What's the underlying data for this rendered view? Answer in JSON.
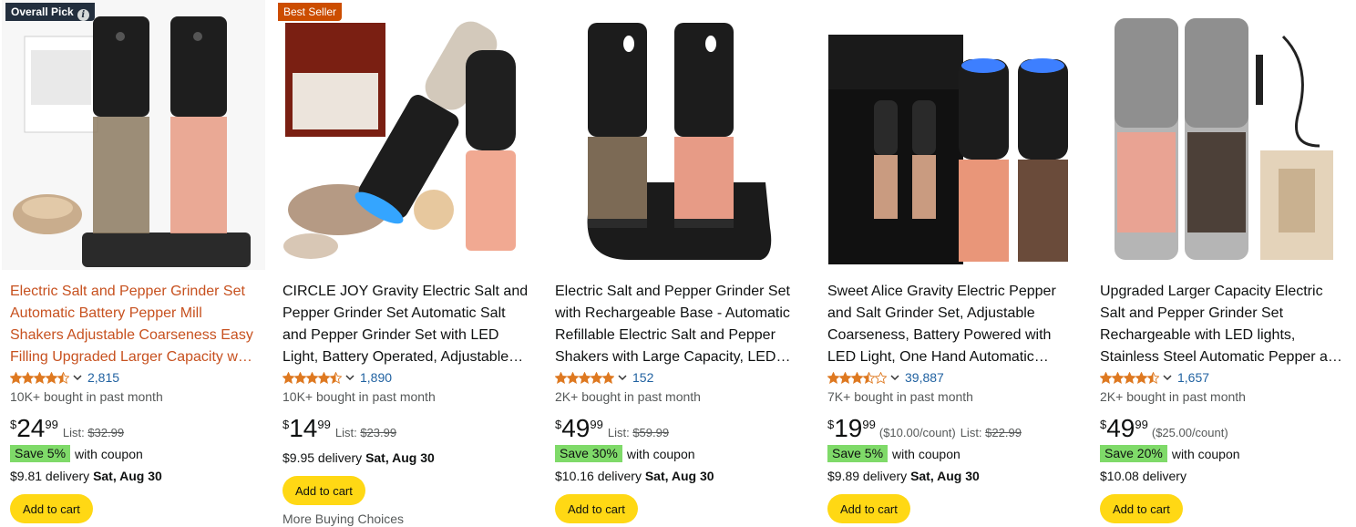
{
  "products": [
    {
      "badge": "Overall Pick",
      "badge_icon": "info-icon",
      "title": "Electric Salt and Pepper Grinder Set Automatic Battery Pepper Mill Shakers Adjustable Coarseness Easy Filling Upgraded Larger Capacity w…",
      "title_color": "#c7511f",
      "rating": 4.5,
      "rating_count": "2,815",
      "bought": "10K+ bought in past month",
      "price_symbol": "$",
      "price_whole": "24",
      "price_fraction": "99",
      "list_label": "List:",
      "list_price": "$32.99",
      "coupon_badge": "Save 5%",
      "coupon_text": "with coupon",
      "delivery_price": "$9.81 delivery",
      "delivery_date": "Sat, Aug 30",
      "cart_label": "Add to cart"
    },
    {
      "badge": "Best Seller",
      "title": "CIRCLE JOY Gravity Electric Salt and Pepper Grinder Set Automatic Salt and Pepper Grinder Set with LED Light, Battery Operated, Adjustable…",
      "rating": 4.5,
      "rating_count": "1,890",
      "bought": "10K+ bought in past month",
      "price_symbol": "$",
      "price_whole": "14",
      "price_fraction": "99",
      "list_label": "List:",
      "list_price": "$23.99",
      "delivery_price": "$9.95 delivery",
      "delivery_date": "Sat, Aug 30",
      "cart_label": "Add to cart",
      "more_choices": "More Buying Choices"
    },
    {
      "title": "Electric Salt and Pepper Grinder Set with Rechargeable Base - Automatic Refillable Electric Salt and Pepper Shakers with Large Capacity, LED…",
      "rating": 5,
      "rating_count": "152",
      "bought": "2K+ bought in past month",
      "price_symbol": "$",
      "price_whole": "49",
      "price_fraction": "99",
      "list_label": "List:",
      "list_price": "$59.99",
      "coupon_badge": "Save 30%",
      "coupon_text": "with coupon",
      "delivery_price": "$10.16 delivery",
      "delivery_date": "Sat, Aug 30",
      "cart_label": "Add to cart"
    },
    {
      "title": "Sweet Alice Gravity Electric Pepper and Salt Grinder Set, Adjustable Coarseness, Battery Powered with LED Light, One Hand Automatic…",
      "rating": 3.5,
      "rating_count": "39,887",
      "bought": "7K+ bought in past month",
      "price_symbol": "$",
      "price_whole": "19",
      "price_fraction": "99",
      "unit_price": "($10.00/count)",
      "list_label": "List:",
      "list_price": "$22.99",
      "coupon_badge": "Save 5%",
      "coupon_text": "with coupon",
      "delivery_price": "$9.89 delivery",
      "delivery_date": "Sat, Aug 30",
      "cart_label": "Add to cart"
    },
    {
      "title": "Upgraded Larger Capacity Electric Salt and Pepper Grinder Set Rechargeable with LED lights, Stainless Steel Automatic Pepper a…",
      "rating": 4.5,
      "rating_count": "1,657",
      "bought": "2K+ bought in past month",
      "price_symbol": "$",
      "price_whole": "49",
      "price_fraction": "99",
      "unit_price": "($25.00/count)",
      "coupon_badge": "Save 20%",
      "coupon_text": "with coupon",
      "delivery_price": "$10.08 delivery",
      "cart_label": "Add to cart"
    }
  ],
  "colors": {
    "star": "#de7921",
    "link": "#2162a1",
    "coupon_bg": "#7fda69",
    "cart_bg": "#ffd814",
    "badge_overall": "#232f3e",
    "badge_best": "#cc4d00"
  }
}
